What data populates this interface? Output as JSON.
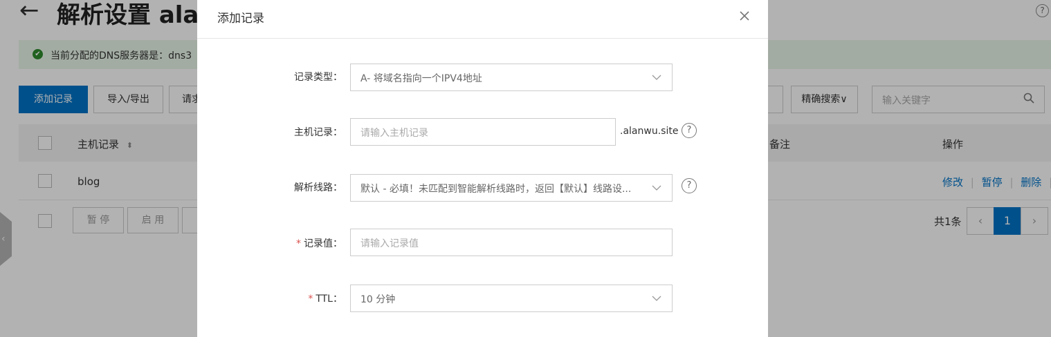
{
  "header": {
    "back_glyph": "←",
    "title": "解析设置 alan",
    "help_glyph": "?"
  },
  "notice": {
    "icon": "check-circle-icon",
    "text": "当前分配的DNS服务器是：dns3"
  },
  "toolbar": {
    "add_record": "添加记录",
    "import_export": "导入/导出",
    "third_button": "请求",
    "exact_search": "精确搜索∨",
    "search_placeholder": "输入关键字"
  },
  "table": {
    "headers": {
      "host": "主机记录",
      "remark": "备注",
      "actions": "操作"
    },
    "rows": [
      {
        "host": "blog",
        "actions": {
          "edit": "修改",
          "pause": "暂停",
          "delete": "删除",
          "sep": "|"
        }
      }
    ],
    "footer": {
      "pause": "暂 停",
      "enable": "启 用",
      "total": "共1条",
      "prev": "‹",
      "page": "1",
      "next": "›"
    }
  },
  "modal": {
    "title": "添加记录",
    "close_glyph": "×",
    "fields": {
      "record_type": {
        "label": "记录类型：",
        "value": "A- 将域名指向一个IPV4地址"
      },
      "host_record": {
        "label": "主机记录：",
        "placeholder": "请输入主机记录",
        "suffix": ".alanwu.site"
      },
      "line": {
        "label": "解析线路：",
        "value": "默认 - 必填！未匹配到智能解析线路时，返回【默认】线路设..."
      },
      "record_value": {
        "label": "记录值：",
        "required": "*",
        "placeholder": "请输入记录值"
      },
      "ttl": {
        "label": "TTL：",
        "required": "*",
        "value": "10 分钟"
      }
    },
    "help_glyph": "?"
  },
  "colors": {
    "primary": "#0073c7",
    "required": "#d9534f",
    "notice_bg": "#eaf6ea",
    "success": "#2e8b2e"
  }
}
